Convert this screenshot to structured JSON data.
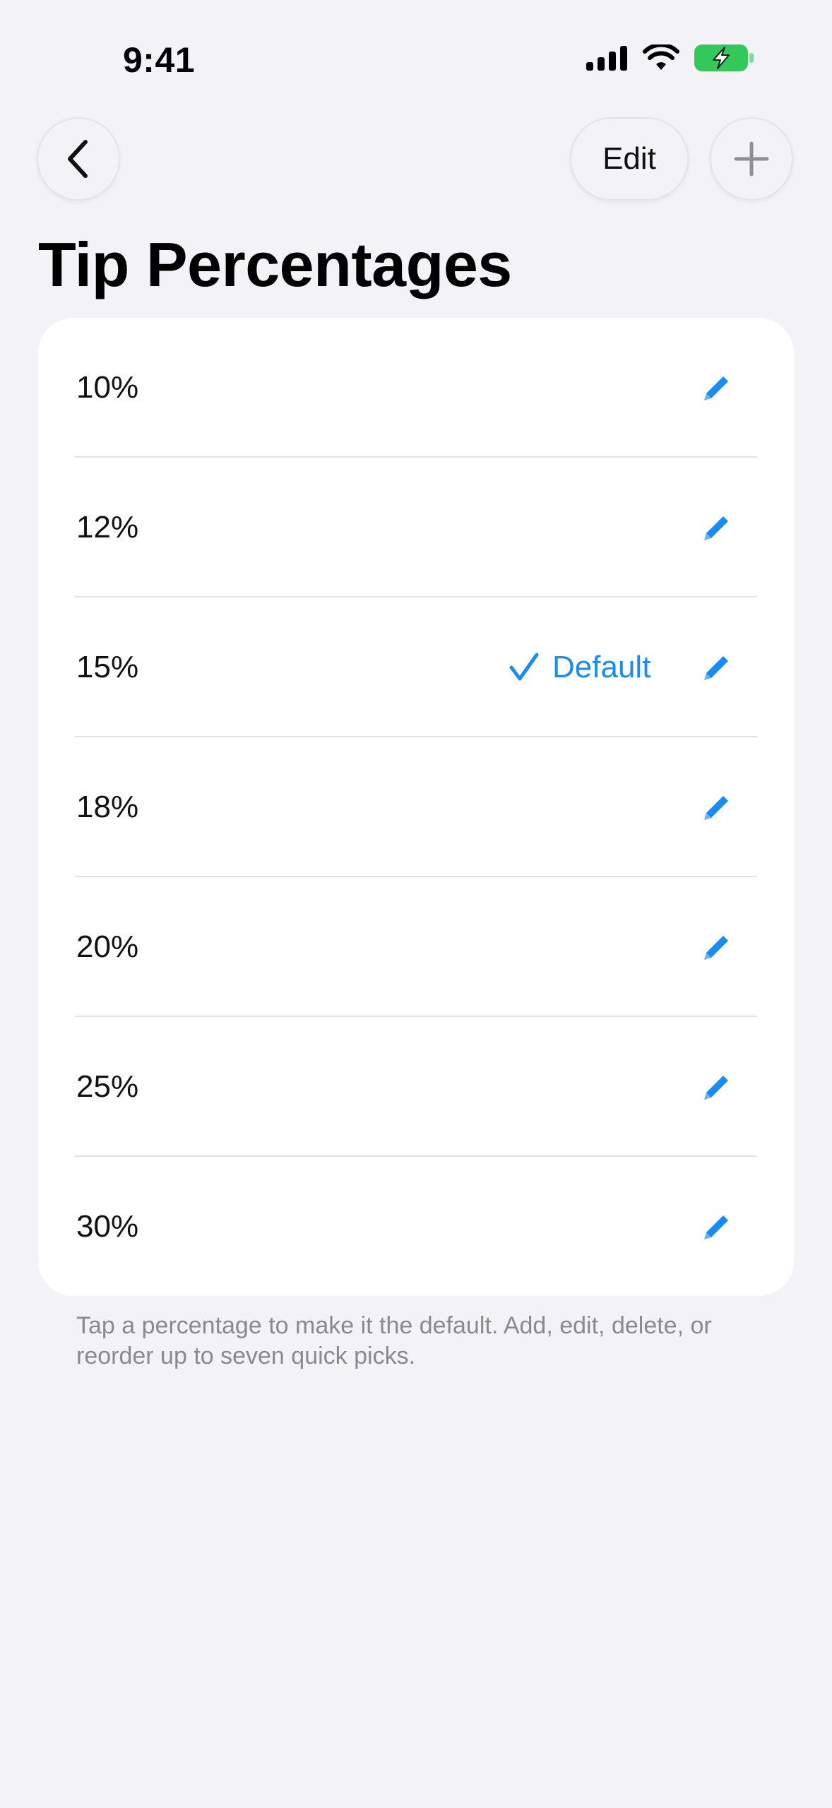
{
  "status_bar": {
    "time": "9:41"
  },
  "nav": {
    "back_icon": "chevron-left",
    "edit_label": "Edit",
    "add_icon": "plus"
  },
  "title": "Tip Percentages",
  "rows": [
    {
      "label": "10%",
      "is_default": false
    },
    {
      "label": "12%",
      "is_default": false
    },
    {
      "label": "15%",
      "is_default": true
    },
    {
      "label": "18%",
      "is_default": false
    },
    {
      "label": "20%",
      "is_default": false
    },
    {
      "label": "25%",
      "is_default": false
    },
    {
      "label": "30%",
      "is_default": false
    }
  ],
  "default_label": "Default",
  "footer": "Tap a percentage to make it the default. Add, edit, delete, or reorder up to seven quick picks.",
  "colors": {
    "accent": "#1a8cf0",
    "battery": "#34c759",
    "background": "#f2f2f7"
  }
}
